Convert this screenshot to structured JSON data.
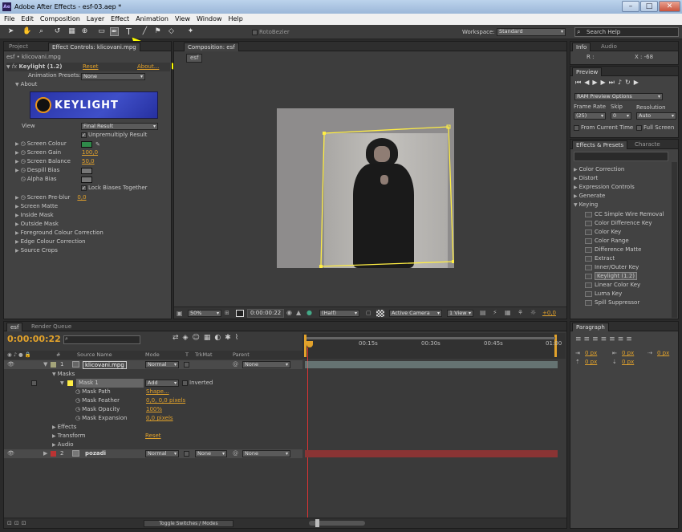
{
  "app": {
    "title": "Adobe After Effects - esf-03.aep *",
    "icon": "Ae"
  },
  "window_controls": [
    "–",
    "□",
    "✕"
  ],
  "menus": [
    "File",
    "Edit",
    "Composition",
    "Layer",
    "Effect",
    "Animation",
    "View",
    "Window",
    "Help"
  ],
  "toolbar": {
    "rotobezier": "RotoBezier",
    "workspace_label": "Workspace:",
    "workspace_value": "Standard",
    "search_placeholder": "Search Help"
  },
  "project_panel": {
    "tab_project": "Project",
    "tab_effect": "Effect Controls: klicovani.mpg",
    "breadcrumb": "esf • klicovani.mpg",
    "effect_name": "Keylight (1.2)",
    "reset": "Reset",
    "about_link": "About...",
    "anim_presets_label": "Animation Presets:",
    "anim_presets_value": "None",
    "about": "About",
    "logo": "KEYLIGHT",
    "view_label": "View",
    "view_value": "Final Result",
    "unpremultiply": "Unpremultiply Result",
    "screen_colour": "Screen Colour",
    "screen_gain": "Screen Gain",
    "screen_gain_val": "100,0",
    "screen_balance": "Screen Balance",
    "screen_balance_val": "50,0",
    "despill": "Despill Bias",
    "alpha": "Alpha Bias",
    "lock": "Lock Biases Together",
    "preblur": "Screen Pre-blur",
    "preblur_val": "0,0",
    "groups": [
      "Screen Matte",
      "Inside Mask",
      "Outside Mask",
      "Foreground Colour Correction",
      "Edge Colour Correction",
      "Source Crops"
    ]
  },
  "composition": {
    "tab": "Composition: esf",
    "subtab": "esf",
    "zoom": "50%",
    "timecode": "0:00:00:22",
    "resolution": "(Half)",
    "camera": "Active Camera",
    "views": "1 View",
    "exposure": "+0,0"
  },
  "info": {
    "tab_info": "Info",
    "tab_audio": "Audio",
    "r": "R :",
    "x": "X : -68"
  },
  "preview": {
    "tab": "Preview",
    "ram": "RAM Preview Options",
    "frame_rate": "Frame Rate",
    "skip": "Skip",
    "resolution": "Resolution",
    "fr_val": "(25)",
    "skip_val": "0",
    "res_val": "Auto",
    "from_current": "From Current Time",
    "full_screen": "Full Screen"
  },
  "effects": {
    "tab": "Effects & Presets",
    "tab2": "Characte",
    "categories": [
      "Color Correction",
      "Distort",
      "Expression Controls",
      "Generate"
    ],
    "keying": "Keying",
    "items": [
      "CC Simple Wire Removal",
      "Color Difference Key",
      "Color Key",
      "Color Range",
      "Difference Matte",
      "Extract",
      "Inner/Outer Key",
      "Keylight (1.2)",
      "Linear Color Key",
      "Luma Key",
      "Spill Suppressor"
    ]
  },
  "paragraph": {
    "tab": "Paragraph",
    "fields": [
      "0 px",
      "0 px",
      "0 px",
      "0 px",
      "0 px"
    ]
  },
  "timeline": {
    "tab_esf": "esf",
    "tab_rq": "Render Queue",
    "timecode": "0:00:00:22",
    "search_placeholder": "",
    "col_num": "#",
    "col_source": "Source Name",
    "col_mode": "Mode",
    "col_t": "T",
    "col_trkmat": "TrkMat",
    "col_parent": "Parent",
    "ruler": [
      "0:00s",
      "00:15s",
      "00:30s",
      "00:45s",
      "01:00"
    ],
    "layer1": {
      "num": "1",
      "name": "klicovani.mpg",
      "mode": "Normal",
      "parent": "None"
    },
    "masks": "Masks",
    "mask1": "Mask 1",
    "mask1_mode": "Add",
    "inverted": "Inverted",
    "mask_props": [
      {
        "label": "Mask Path",
        "value": "Shape..."
      },
      {
        "label": "Mask Feather",
        "value": "0,0, 0,0 pixels"
      },
      {
        "label": "Mask Opacity",
        "value": "100%"
      },
      {
        "label": "Mask Expansion",
        "value": "0,0 pixels"
      }
    ],
    "effects": "Effects",
    "transform": "Transform",
    "transform_reset": "Reset",
    "audio": "Audio",
    "layer2": {
      "num": "2",
      "name": "pozadi",
      "mode": "Normal",
      "trkmat": "None",
      "parent": "None"
    },
    "toggle": "Toggle Switches / Modes"
  },
  "colors": {
    "accent": "#e2a22b",
    "layer_bar": "#8a3434",
    "mask_yellow": "#ffee44",
    "arrow": "#ffff00"
  }
}
